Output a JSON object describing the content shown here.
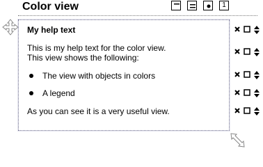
{
  "view": {
    "title": "Color view"
  },
  "toolbar": {
    "buttons": [
      {
        "name": "window-header-icon"
      },
      {
        "name": "list-align-icon"
      },
      {
        "name": "bullet-icon"
      },
      {
        "name": "numbered-icon",
        "label": "1"
      }
    ]
  },
  "help": {
    "title": "My help text",
    "intro_line1": "This is my help text for the color view.",
    "intro_line2": "This view shows the following:",
    "bullets": [
      "The view with objects in colors",
      "A legend"
    ],
    "closing": "As you can see it is a very useful view."
  },
  "row_controls": {
    "icons": [
      "delete-icon",
      "checkbox-icon",
      "reorder-icon"
    ]
  }
}
